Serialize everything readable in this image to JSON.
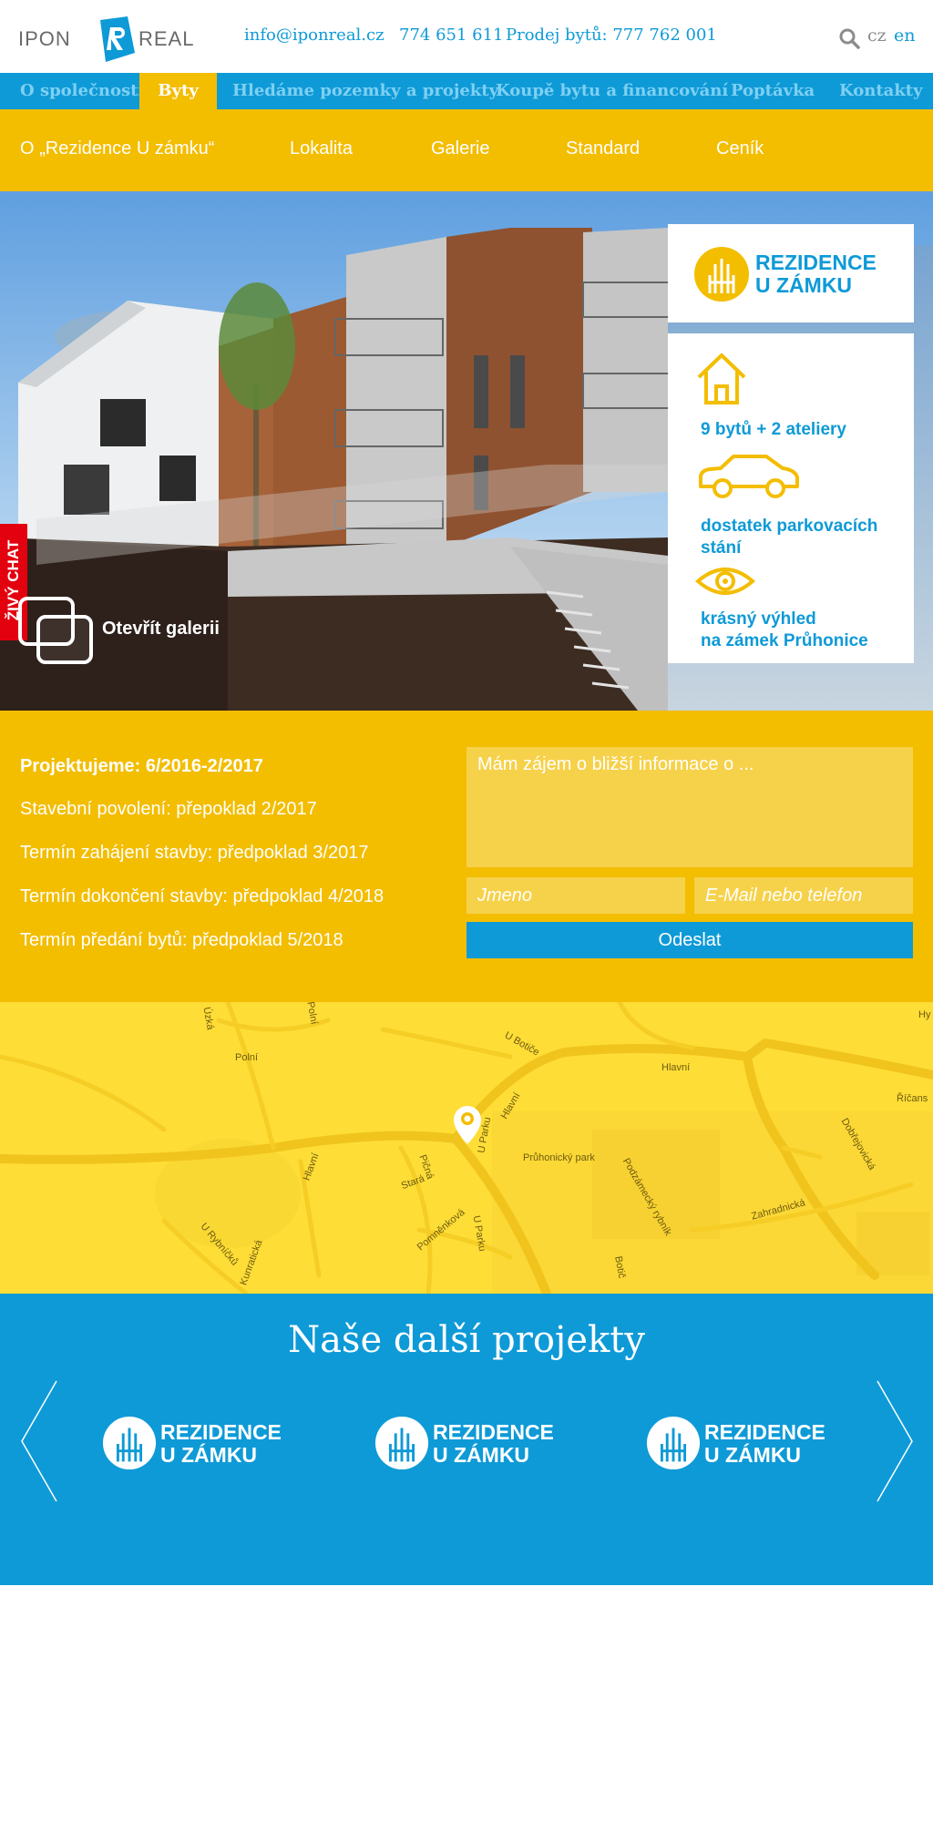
{
  "header": {
    "logo_left": "IPON",
    "logo_right": "REAL",
    "email": "info@iponreal.cz",
    "phone": "774 651 611",
    "sales": "Prodej bytů: 777 762 001",
    "lang_cz": "cz",
    "lang_en": "en"
  },
  "main_nav": [
    "O společnosti",
    "Byty",
    "Hledáme pozemky a projekty",
    "Koupě bytu a financování",
    "Poptávka",
    "Kontakty"
  ],
  "sub_nav": [
    "O „Rezidence U zámku“",
    "Lokalita",
    "Galerie",
    "Standard",
    "Ceník"
  ],
  "hero": {
    "chat": "ŽIVÝ CHAT",
    "gallery": "Otevřít galerii",
    "brand_line1": "REZIDENCE",
    "brand_line2": "U ZÁMKU",
    "features": [
      {
        "icon": "house-icon",
        "line1": "9 bytů + 2 ateliery",
        "line2": ""
      },
      {
        "icon": "car-icon",
        "line1": "dostatek parkovacích",
        "line2": "stání"
      },
      {
        "icon": "eye-icon",
        "line1": "krásný výhled",
        "line2": "na zámek Průhonice"
      }
    ]
  },
  "info": {
    "lines": [
      "Projektujeme: 6/2016-2/2017",
      "Stavební povolení: přepoklad 2/2017",
      "Termín zahájení stavby: předpoklad 3/2017",
      "Termín dokončení stavby: předpoklad 4/2018",
      "Termín předání bytů: předpoklad 5/2018"
    ],
    "form": {
      "message_placeholder": "Mám zájem o bližší informace o ...",
      "name_placeholder": "Jmeno",
      "contact_placeholder": "E-Mail nebo telefon",
      "submit": "Odeslat"
    }
  },
  "map": {
    "labels": [
      "Polní",
      "U Botiče",
      "Hlavní",
      "Hlavní",
      "Říčans",
      "Dobřejovická",
      "Průhonický park",
      "Pičná",
      "Stará",
      "U Parku",
      "Hlavní",
      "Podzámecký rybník",
      "Zahradnická",
      "Botič",
      "Pomněnková",
      "U Parku",
      "U Rybníčků",
      "Kunratická",
      "Hy",
      "Úzká",
      "Polní"
    ]
  },
  "projects": {
    "title": "Naše další projekty",
    "items": [
      {
        "line1": "REZIDENCE",
        "line2": "U ZÁMKU"
      },
      {
        "line1": "REZIDENCE",
        "line2": "U ZÁMKU"
      },
      {
        "line1": "REZIDENCE",
        "line2": "U ZÁMKU"
      }
    ]
  },
  "colors": {
    "blue": "#0e9ad7",
    "yellow": "#f3bd00",
    "map_yellow": "#fedd37",
    "chat_red": "#e3000f"
  }
}
